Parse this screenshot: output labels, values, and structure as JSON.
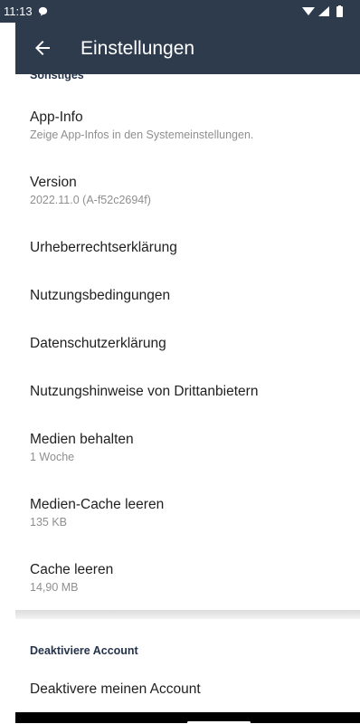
{
  "status_bar": {
    "time": "11:13",
    "icons": [
      "chat-notification-icon",
      "wifi-icon",
      "signal-icon",
      "battery-icon"
    ]
  },
  "app_bar": {
    "title": "Einstellungen",
    "back_icon": "arrow-left-icon"
  },
  "sections": {
    "misc": {
      "title": "Sonstiges",
      "items": [
        {
          "title": "App-Info",
          "subtitle": "Zeige App-Infos in den Systemeinstellungen."
        },
        {
          "title": "Version",
          "subtitle": "2022.11.0 (A-f52c2694f)"
        },
        {
          "title": "Urheberrechtserklärung"
        },
        {
          "title": "Nutzungsbedingungen"
        },
        {
          "title": "Datenschutzerklärung"
        },
        {
          "title": "Nutzungshinweise von Drittanbietern"
        },
        {
          "title": "Medien behalten",
          "subtitle": "1 Woche"
        },
        {
          "title": "Medien-Cache leeren",
          "subtitle": "135 KB"
        },
        {
          "title": "Cache leeren",
          "subtitle": "14,90 MB"
        }
      ]
    },
    "account": {
      "title": "Deaktiviere Account",
      "items": [
        {
          "title": "Deaktivere meinen Account"
        }
      ]
    }
  },
  "colors": {
    "app_bar": "#2d3b4d",
    "section_title": "#24324a",
    "secondary_text": "#8f8f8f"
  }
}
